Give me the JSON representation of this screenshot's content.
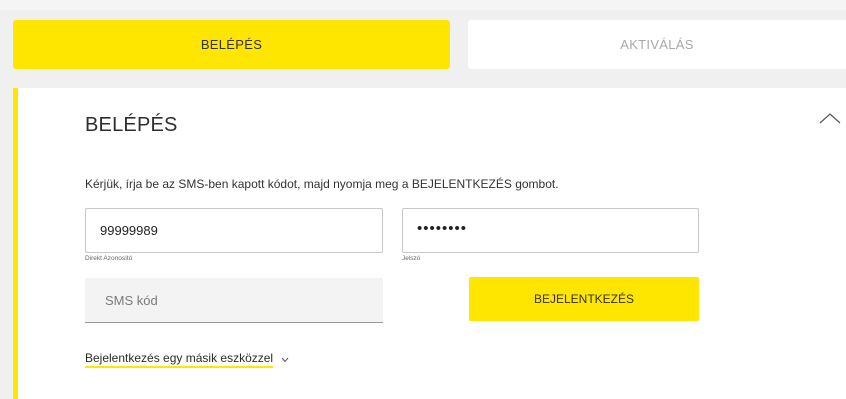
{
  "tabs": [
    {
      "label": "BELÉPÉS",
      "active": true
    },
    {
      "label": "AKTIVÁLÁS",
      "active": false
    }
  ],
  "panel": {
    "title": "BELÉPÉS",
    "collapse_icon": "chevron-up-icon",
    "instruction": "Kérjük, írja be az SMS-ben kapott kódot, majd nyomja meg a BEJELENTKEZÉS gombot."
  },
  "form": {
    "direct_id": {
      "value": "99999989",
      "caption": "Direkt Azonosító"
    },
    "password": {
      "value": "••••••••",
      "caption": "Jelszó"
    },
    "sms_code": {
      "placeholder": "SMS kód"
    },
    "login_button": "BEJELENTKEZÉS",
    "other_device": {
      "label": "Bejelentkezés egy másik eszközzel",
      "icon": "chevron-down-icon"
    }
  },
  "colors": {
    "accent": "#ffe600",
    "background": "#f0f0f0",
    "panel": "#ffffff",
    "inactive_tab_text": "#a8a8a8"
  }
}
